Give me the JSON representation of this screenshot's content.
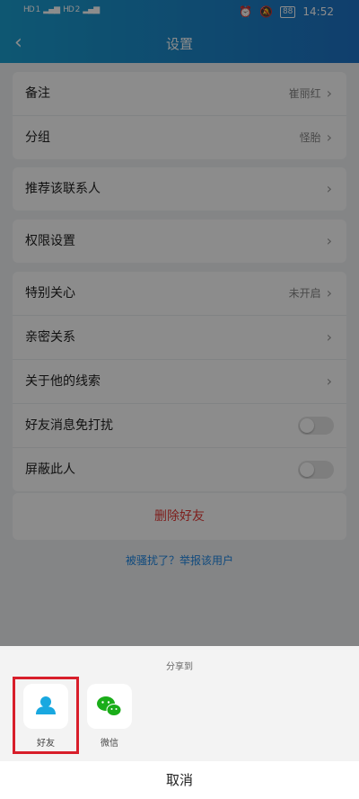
{
  "status_bar": {
    "left_signal_1": "HD 1",
    "left_signal_2": "HD 2",
    "battery": "88",
    "time": "14:52"
  },
  "header": {
    "title": "设置"
  },
  "group1": [
    {
      "label": "备注",
      "value": "崔丽红"
    },
    {
      "label": "分组",
      "value": "怪胎"
    }
  ],
  "group2": [
    {
      "label": "推荐该联系人"
    }
  ],
  "group3": [
    {
      "label": "权限设置"
    }
  ],
  "group4": [
    {
      "label": "特别关心",
      "value": "未开启"
    },
    {
      "label": "亲密关系"
    },
    {
      "label": "关于他的线索"
    },
    {
      "label": "好友消息免打扰",
      "toggle": false
    },
    {
      "label": "屏蔽此人",
      "toggle": false
    }
  ],
  "delete_button": "删除好友",
  "report_link": "被骚扰了？举报该用户",
  "share_sheet": {
    "title": "分享到",
    "items": [
      {
        "label": "好友",
        "icon": "person-icon"
      },
      {
        "label": "微信",
        "icon": "wechat-icon"
      }
    ],
    "cancel": "取消"
  },
  "colors": {
    "header_start": "#1a9fd0",
    "header_end": "#1e73c6",
    "delete": "#e53935",
    "link": "#1e88e5",
    "highlight": "#d81e2a",
    "wechat": "#1aad19"
  }
}
